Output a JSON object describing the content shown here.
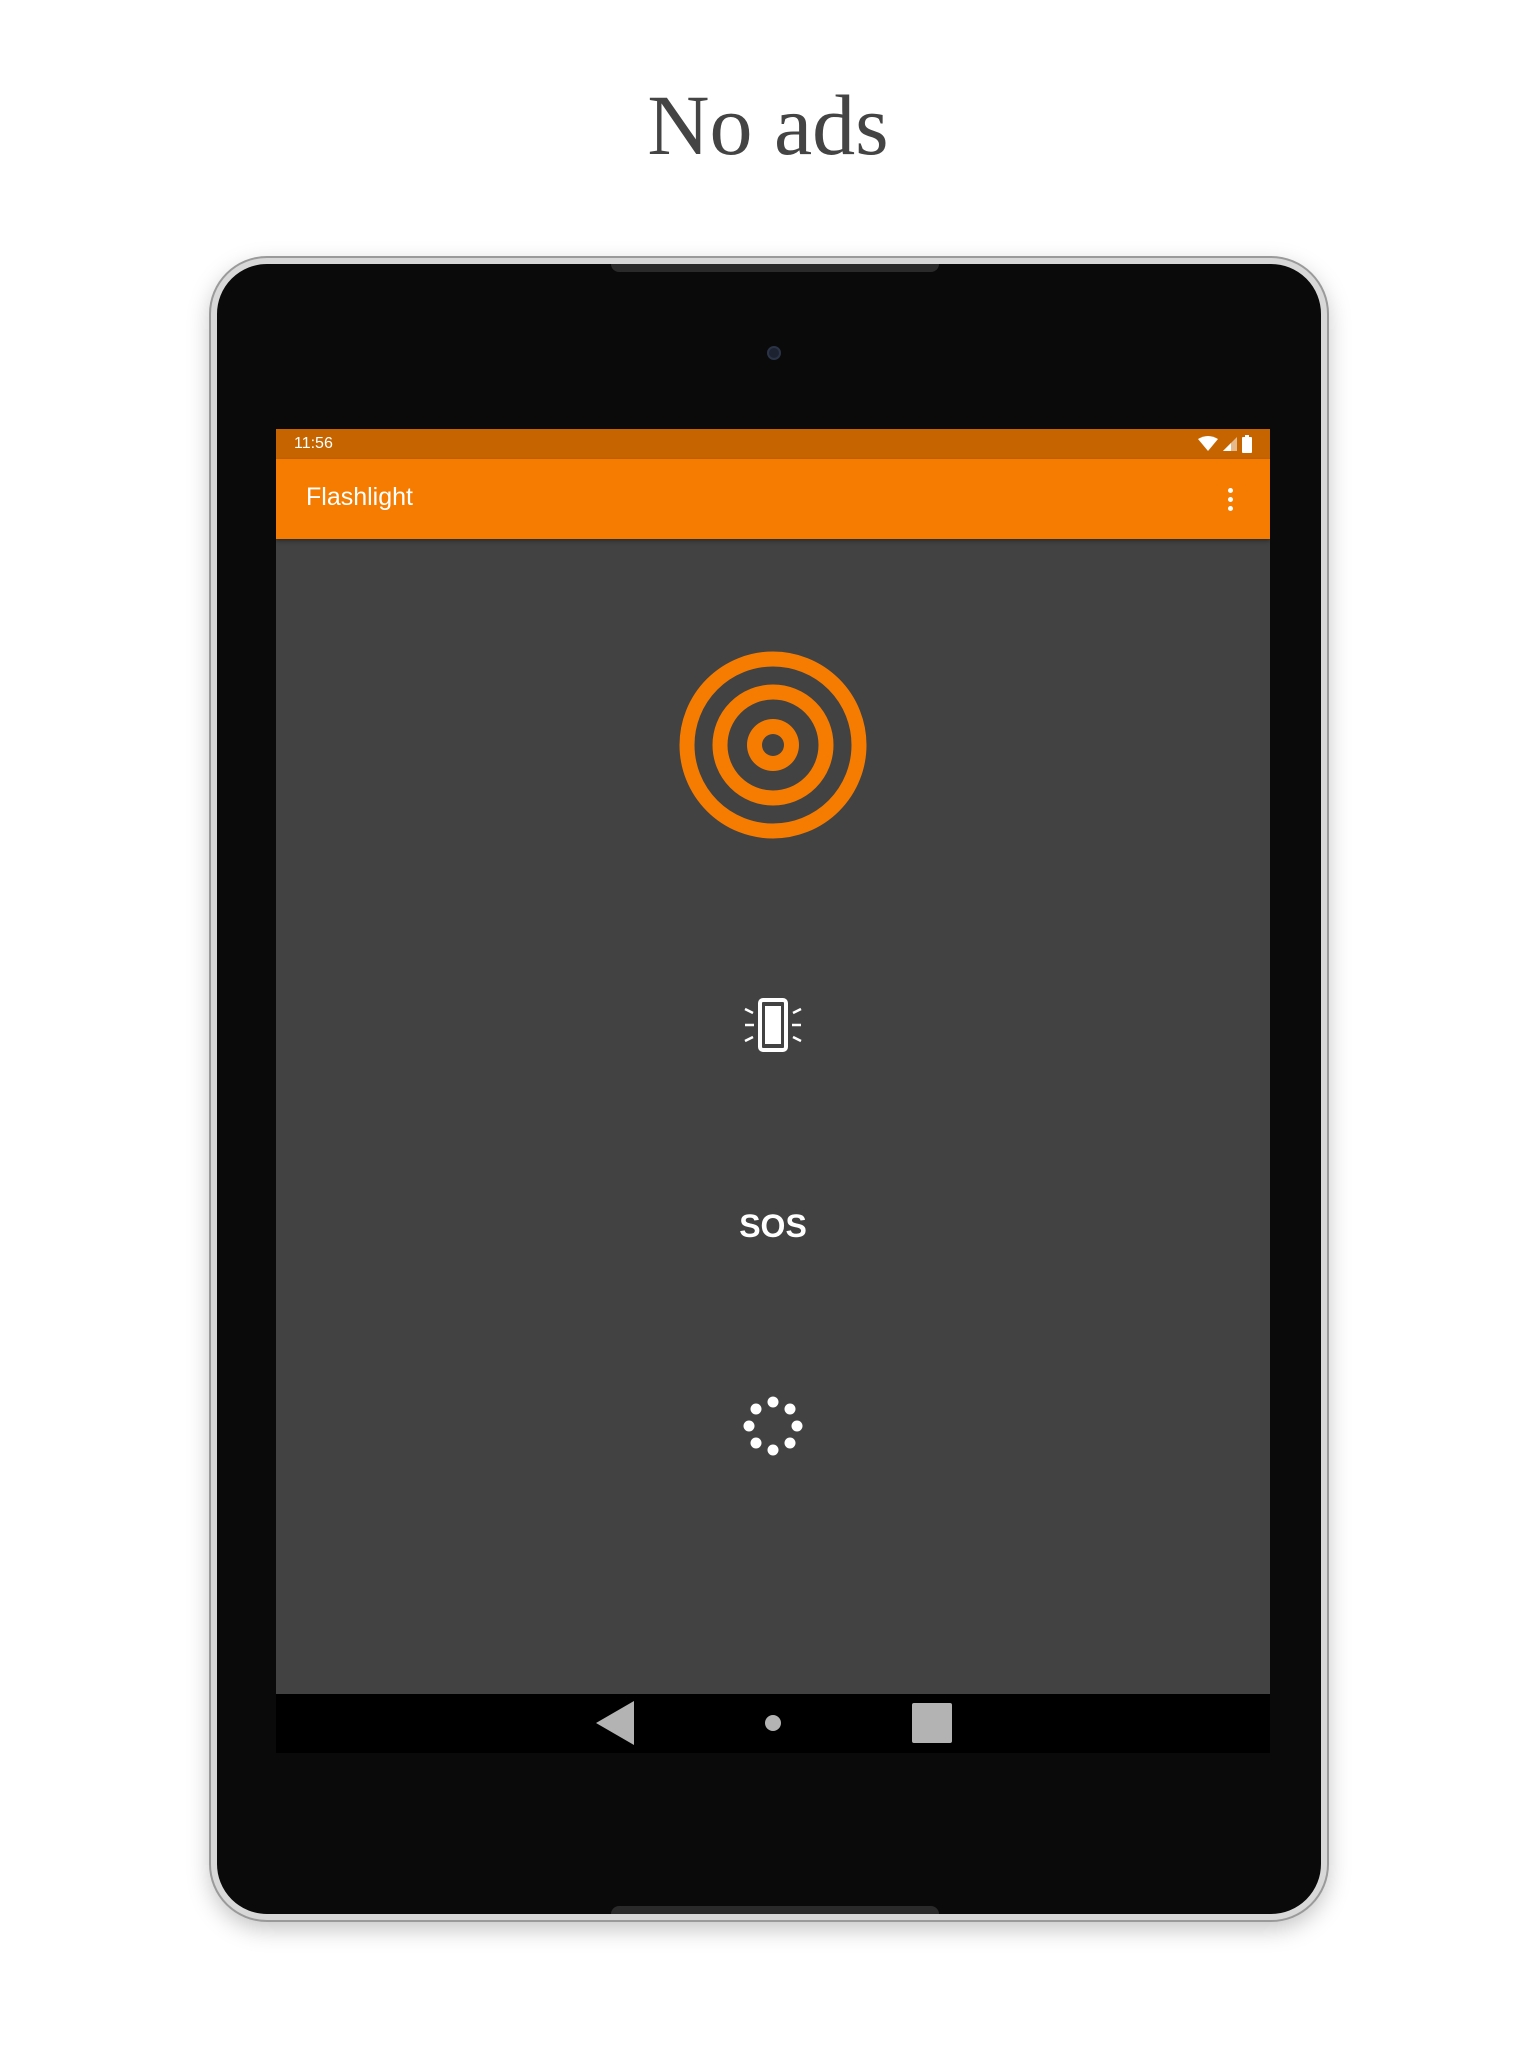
{
  "headline": "No ads",
  "status_bar": {
    "time": "11:56",
    "icons": [
      "wifi-icon",
      "signal-icon",
      "battery-icon"
    ]
  },
  "app_bar": {
    "title": "Flashlight",
    "menu_icon": "overflow-menu-icon"
  },
  "controls": {
    "power_icon": "power-target-icon",
    "vibrate_icon": "vibrate-phone-icon",
    "sos_label": "SOS",
    "strobe_icon": "strobe-dots-icon"
  },
  "nav_bar": {
    "icons": [
      "back-icon",
      "home-icon",
      "recents-icon"
    ]
  },
  "colors": {
    "accent": "#f57c00",
    "status_bar": "#c66500",
    "background": "#424242",
    "nav_bar": "#000000"
  }
}
